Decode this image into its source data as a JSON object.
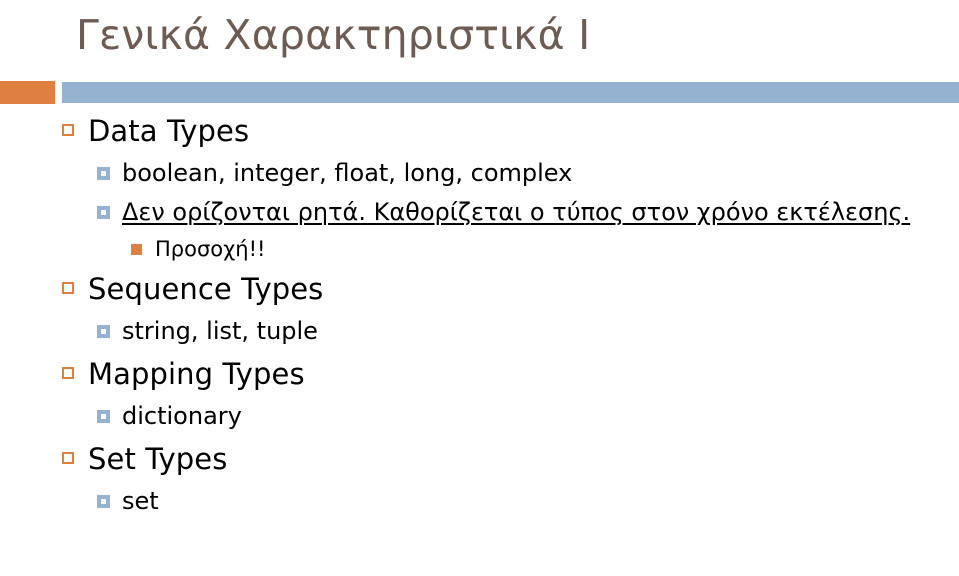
{
  "slide": {
    "title": "Γενικά Χαρακτηριστικά Ι",
    "theme": {
      "title_color": "#6E5B52",
      "accent_orange": "#DF8040",
      "accent_blue": "#95B3D0",
      "body_color": "#000000",
      "background": "#FFFFFF"
    },
    "divider": {
      "block_color": "#DF8040",
      "bar_color": "#95B3D0"
    },
    "outline": [
      {
        "level": 1,
        "text": "Data Types",
        "bullet": "hollow-orange-square-bullet",
        "underline": false
      },
      {
        "level": 2,
        "text": "boolean, integer, float, long, complex",
        "bullet": "blue-square-bullet",
        "underline": false
      },
      {
        "level": 2,
        "text": "Δεν ορίζονται ρητά. Καθορίζεται ο τύπος στον χρόνο εκτέλεσης.",
        "bullet": "blue-square-bullet",
        "underline": true
      },
      {
        "level": 3,
        "text": "Προσοχή!!",
        "bullet": "solid-orange-square-bullet",
        "underline": false
      },
      {
        "level": 1,
        "text": "Sequence Types",
        "bullet": "hollow-orange-square-bullet",
        "underline": false
      },
      {
        "level": 2,
        "text": "string, list, tuple",
        "bullet": "blue-square-bullet",
        "underline": false
      },
      {
        "level": 1,
        "text": "Mapping Types",
        "bullet": "hollow-orange-square-bullet",
        "underline": false
      },
      {
        "level": 2,
        "text": "dictionary",
        "bullet": "blue-square-bullet",
        "underline": false
      },
      {
        "level": 1,
        "text": "Set Types",
        "bullet": "hollow-orange-square-bullet",
        "underline": false
      },
      {
        "level": 2,
        "text": "set",
        "bullet": "blue-square-bullet",
        "underline": false
      }
    ]
  }
}
